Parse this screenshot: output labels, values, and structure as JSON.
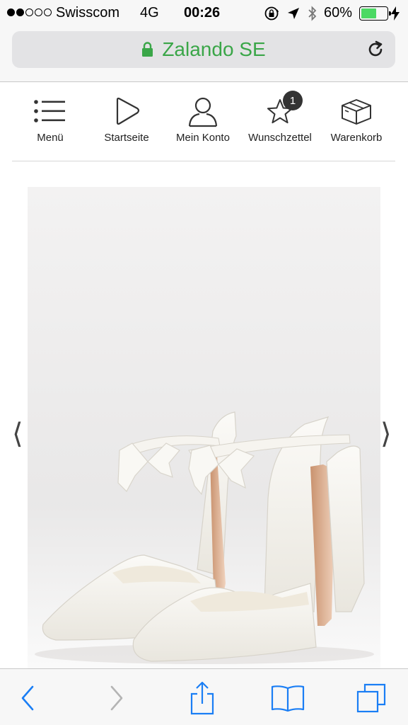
{
  "status_bar": {
    "carrier": "Swisscom",
    "network": "4G",
    "time": "00:26",
    "battery_percent": "60%",
    "battery_level": 0.6,
    "signal_bars_filled": 2,
    "signal_bars_total": 5
  },
  "browser": {
    "url_domain": "Zalando SE",
    "secure": true,
    "accent_color": "#3aa648"
  },
  "site_nav": {
    "items": [
      {
        "label": "Menü",
        "icon": "menu-icon"
      },
      {
        "label": "Startseite",
        "icon": "home-play-icon"
      },
      {
        "label": "Mein Konto",
        "icon": "user-icon"
      },
      {
        "label": "Wunschzettel",
        "icon": "star-icon",
        "badge": "1"
      },
      {
        "label": "Warenkorb",
        "icon": "box-icon"
      }
    ]
  },
  "product": {
    "image_description_icon": "shoe-image",
    "prev_glyph": "⟨",
    "next_glyph": "⟩"
  },
  "toolbar": {
    "buttons": [
      "back-icon",
      "forward-icon",
      "share-icon",
      "bookmarks-icon",
      "tabs-icon"
    ],
    "icon_color": "#1a7ef5",
    "disabled_color": "#b4b4b4"
  }
}
